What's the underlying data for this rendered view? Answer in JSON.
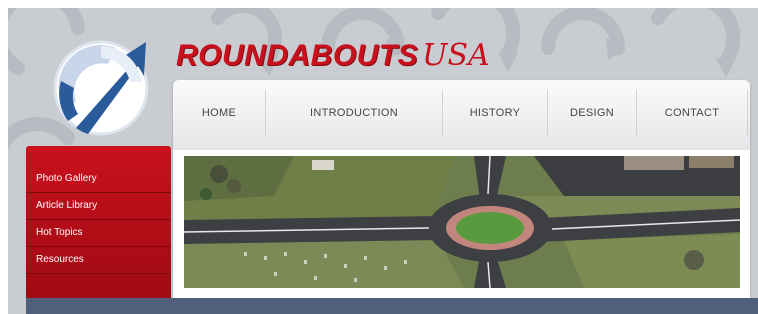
{
  "site": {
    "brand_main": "ROUNDABOUTS",
    "brand_accent": "USA"
  },
  "nav": {
    "items": [
      {
        "label": "HOME"
      },
      {
        "label": "INTRODUCTION"
      },
      {
        "label": "HISTORY"
      },
      {
        "label": "DESIGN"
      },
      {
        "label": "CONTACT"
      }
    ]
  },
  "sidebar": {
    "items": [
      {
        "label": "Photo Gallery"
      },
      {
        "label": "Article Library"
      },
      {
        "label": "Hot Topics"
      },
      {
        "label": "Resources"
      }
    ]
  },
  "colors": {
    "brand_red": "#c8111d",
    "logo_blue": "#2a5b9a",
    "page_gray": "#c9ccd1",
    "bottom_strip": "#51607a"
  },
  "icons": {
    "logo": "circular-arrow-logo-icon",
    "background": "roundabout-arrows-pattern"
  },
  "hero": {
    "subject": "aerial-roundabout-photo"
  }
}
